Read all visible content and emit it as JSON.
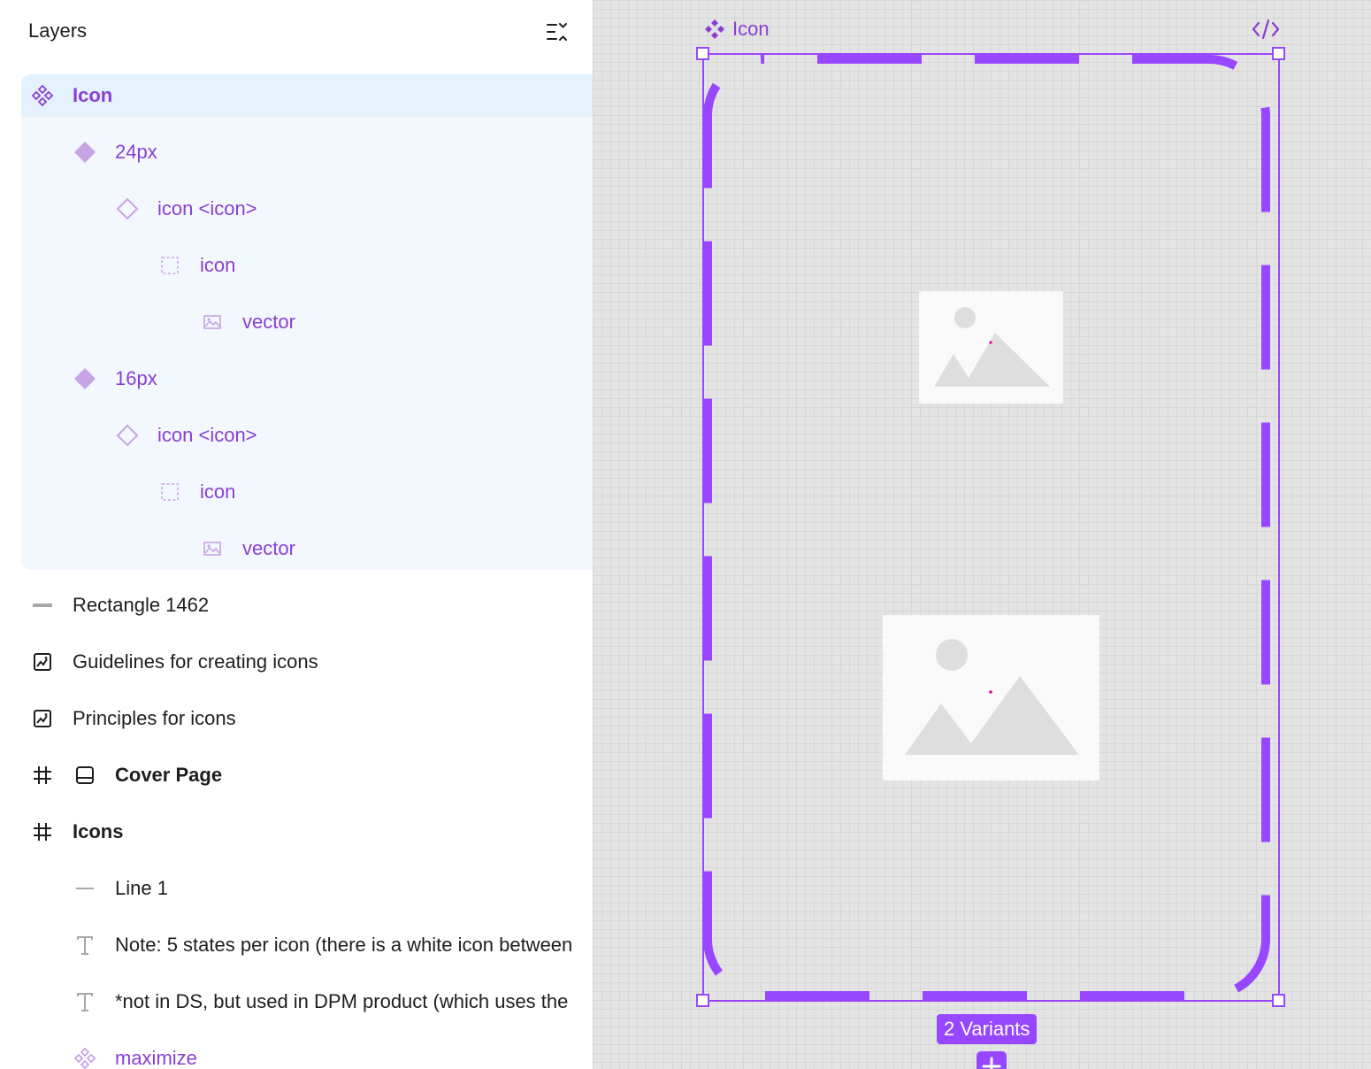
{
  "layers_panel": {
    "title": "Layers",
    "collapse_icon": "collapse-layers-icon",
    "rows": [
      {
        "label": "Icon",
        "icon": "component-set-icon"
      },
      {
        "label": "24px",
        "icon": "component-filled-icon"
      },
      {
        "label": "icon <icon>",
        "icon": "instance-icon"
      },
      {
        "label": "icon",
        "icon": "dashed-frame-icon"
      },
      {
        "label": "vector",
        "icon": "image-icon"
      },
      {
        "label": "16px",
        "icon": "component-filled-icon"
      },
      {
        "label": "icon <icon>",
        "icon": "instance-icon"
      },
      {
        "label": "icon",
        "icon": "dashed-frame-icon"
      },
      {
        "label": "vector",
        "icon": "image-icon"
      },
      {
        "label": "Rectangle 1462",
        "icon": "rectangle-line-icon"
      },
      {
        "label": "Guidelines for creating icons",
        "icon": "embed-image-icon"
      },
      {
        "label": "Principles for icons",
        "icon": "embed-image-icon"
      },
      {
        "label": "Cover Page",
        "icon": "frame-hash-icon",
        "icon2": "page-layout-icon"
      },
      {
        "label": "Icons",
        "icon": "frame-hash-icon"
      },
      {
        "label": "Line 1",
        "icon": "line-icon"
      },
      {
        "label": "Note: 5 states per icon (there is a white icon between",
        "icon": "text-icon"
      },
      {
        "label": "*not in DS, but used in DPM product (which uses the",
        "icon": "text-icon"
      },
      {
        "label": "maximize",
        "icon": "component-set-icon"
      }
    ]
  },
  "canvas": {
    "frame_label": "Icon",
    "frame_icon": "component-set-icon",
    "code_icon": "code-icon",
    "variants_badge": "2 Variants",
    "add_variant_icon": "plus-icon",
    "placeholder_icon": "image-placeholder-icon"
  },
  "colors": {
    "accent": "#9747ff",
    "accent_text": "#8a3fd3",
    "selection_bg": "#f3f8fe",
    "selection_head_bg": "#e4f2fd",
    "canvas_bg": "#e4e4e4"
  }
}
